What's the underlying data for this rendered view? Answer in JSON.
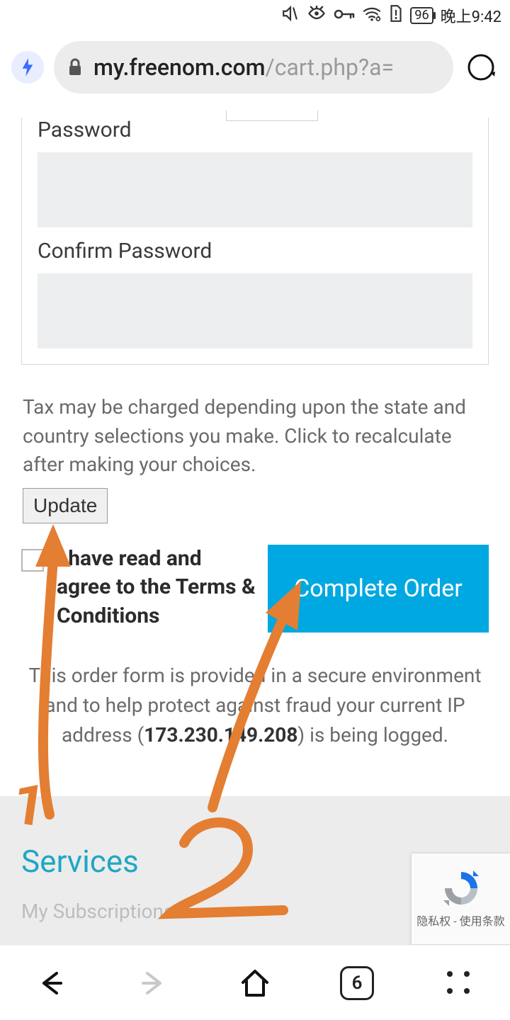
{
  "status": {
    "battery": "96",
    "time": "晚上9:42"
  },
  "browser": {
    "domain": "my.freenom.com",
    "path": "/cart.php?a="
  },
  "form": {
    "password_label": "Password",
    "confirm_label": "Confirm Password"
  },
  "tax_note": "Tax may be charged depending upon the state and country selections you make. Click to recalculate after making your choices.",
  "update_btn": "Update",
  "terms": {
    "text": "I have read and agree to the Terms & Conditions"
  },
  "complete_btn": "Complete Order",
  "secure": {
    "pre": "This order form is provided in a secure environment and to help protect against fraud your current IP address (",
    "ip": "173.230.149.208",
    "post": ") is being logged."
  },
  "footer": {
    "services": "Services",
    "subs": "My Subscriptions"
  },
  "recaptcha": {
    "privacy": "隐私权",
    "dash": " - ",
    "terms": "使用条款"
  },
  "nav": {
    "tabs": "6"
  },
  "annotations": {
    "one": "1",
    "two": "2"
  }
}
